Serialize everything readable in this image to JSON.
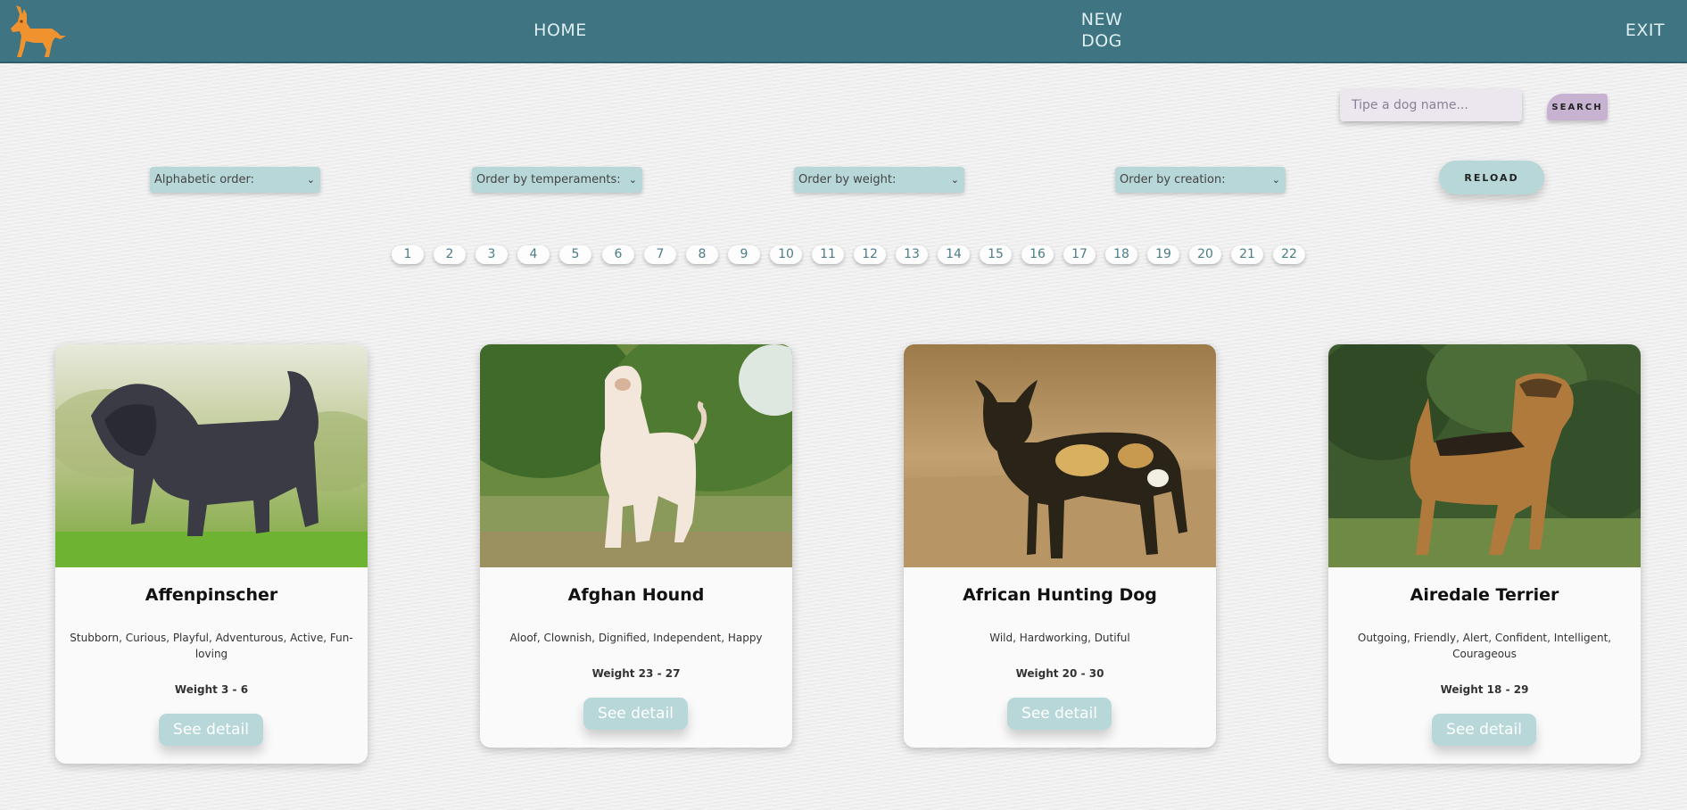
{
  "nav": {
    "logo_icon": "dog-logo-icon",
    "home": "HOME",
    "new_dog_line1": "NEW",
    "new_dog_line2": "DOG",
    "exit": "EXIT",
    "color": "#3f7582"
  },
  "search": {
    "placeholder": "Tipe a dog name...",
    "button": "SEARCH"
  },
  "filters": {
    "alphabetic": "Alphabetic order:",
    "temperaments": "Order by temperaments:",
    "weight": "Order by weight:",
    "creation": "Order by creation:",
    "reload": "RELOAD"
  },
  "pagination": [
    "1",
    "2",
    "3",
    "4",
    "5",
    "6",
    "7",
    "8",
    "9",
    "10",
    "11",
    "12",
    "13",
    "14",
    "15",
    "16",
    "17",
    "18",
    "19",
    "20",
    "21",
    "22"
  ],
  "cards": [
    {
      "name": "Affenpinscher",
      "temperament": "Stubborn, Curious, Playful, Adventurous, Active, Fun-loving",
      "weight": "Weight 3 - 6",
      "button": "See detail",
      "image": "affenpinscher-photo"
    },
    {
      "name": "Afghan Hound",
      "temperament": "Aloof, Clownish, Dignified, Independent, Happy",
      "weight": "Weight 23 - 27",
      "button": "See detail",
      "image": "afghan-hound-photo"
    },
    {
      "name": "African Hunting Dog",
      "temperament": "Wild, Hardworking, Dutiful",
      "weight": "Weight 20 - 30",
      "button": "See detail",
      "image": "african-hunting-dog-photo"
    },
    {
      "name": "Airedale Terrier",
      "temperament": "Outgoing, Friendly, Alert, Confident, Intelligent, Courageous",
      "weight": "Weight 18 - 29",
      "button": "See detail",
      "image": "airedale-terrier-photo"
    }
  ]
}
